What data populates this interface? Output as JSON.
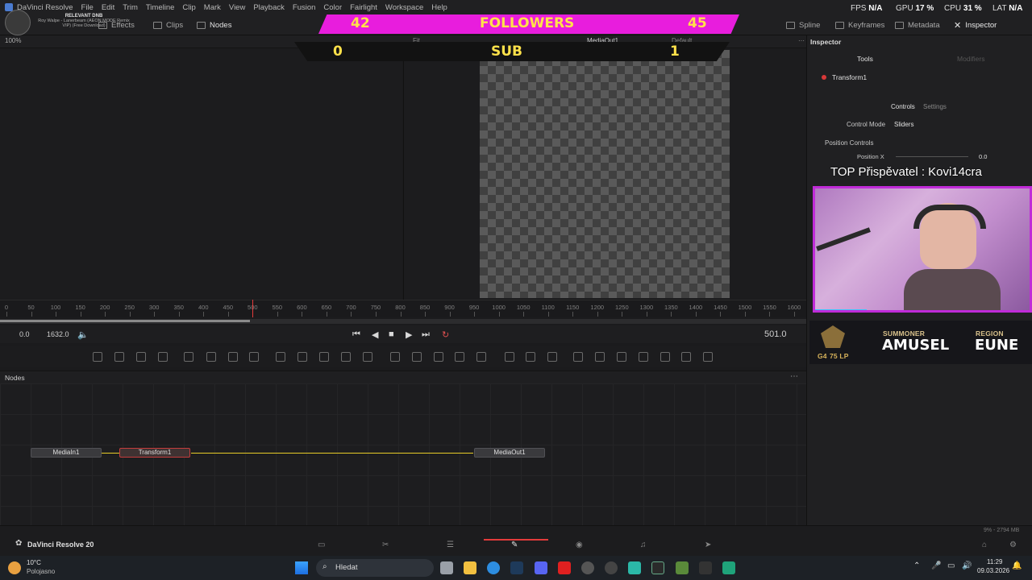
{
  "menu": [
    "DaVinci Resolve",
    "File",
    "Edit",
    "Trim",
    "Timeline",
    "Clip",
    "Mark",
    "View",
    "Playback",
    "Fusion",
    "Color",
    "Fairlight",
    "Workspace",
    "Help"
  ],
  "toolbar": {
    "zoom": "100%",
    "effects": "Effects",
    "clips": "Clips",
    "nodes": "Nodes",
    "spline": "Spline",
    "keyframes": "Keyframes",
    "metadata": "Metadata",
    "inspector": "Inspector"
  },
  "stats": {
    "fps_label": "FPS",
    "fps_value": "N/A",
    "gpu_label": "GPU",
    "gpu_value": "17 %",
    "cpu_label": "CPU",
    "cpu_value": "31 %",
    "lat_label": "LAT",
    "lat_value": "N/A"
  },
  "viewer": {
    "fit": "Fit",
    "output_name": "MediaOut1",
    "default": "Default"
  },
  "music_widget": {
    "title": "RELEVANT DNB",
    "subtitle": "Roy Walpe - Lanerbeam (AEON MODE Remix VIP) (Free Download)"
  },
  "overlay": {
    "followers_left": "42",
    "followers_label": "FOLLOWERS",
    "followers_right": "45",
    "sub_left": "0",
    "sub_label": "SUB",
    "sub_right": "1",
    "top_donor": "TOP Přispěvatel : Kovi14cra"
  },
  "ruler": {
    "ticks": [
      "0",
      "50",
      "100",
      "150",
      "200",
      "250",
      "300",
      "350",
      "400",
      "450",
      "500",
      "550",
      "600",
      "650",
      "700",
      "750",
      "800",
      "850",
      "900",
      "950",
      "1000",
      "1050",
      "1100",
      "1150",
      "1200",
      "1250",
      "1300",
      "1350",
      "1400",
      "1450",
      "1500",
      "1550",
      "1600"
    ],
    "scrub_progress": 0.31
  },
  "transport": {
    "start": "0.0",
    "end": "1632.0",
    "current": "501.0"
  },
  "nodes_panel": {
    "title": "Nodes",
    "nodes": [
      "MediaIn1",
      "Transform1",
      "MediaOut1"
    ]
  },
  "inspector": {
    "title": "Inspector",
    "tab_tools": "Tools",
    "tab_modifiers": "Modifiers",
    "tool_name": "Transform1",
    "controls": "Controls",
    "settings": "Settings",
    "control_mode_label": "Control Mode",
    "control_mode_value": "Sliders",
    "section": "Position Controls",
    "position_x_label": "Position X",
    "position_x_value": "0.0"
  },
  "lol": {
    "rank": "G4",
    "lp": "75 LP",
    "summoner_label": "SUMMONER",
    "summoner": "AMUSEL",
    "region_label": "REGION",
    "region": "EUNE"
  },
  "pages_bar": {
    "app_name": "DaVinci Resolve 20",
    "memory": "9% - 2794 MB"
  },
  "taskbar": {
    "temperature": "10°C",
    "weather": "Polojasno",
    "search": "Hledat",
    "time": "11:29",
    "date": "09.03.2026"
  },
  "colors": {
    "accent_magenta": "#e81ddd",
    "followers_text": "#ffe14a",
    "playhead": "#e23b3b",
    "link_yellow": "#e8cc28"
  }
}
